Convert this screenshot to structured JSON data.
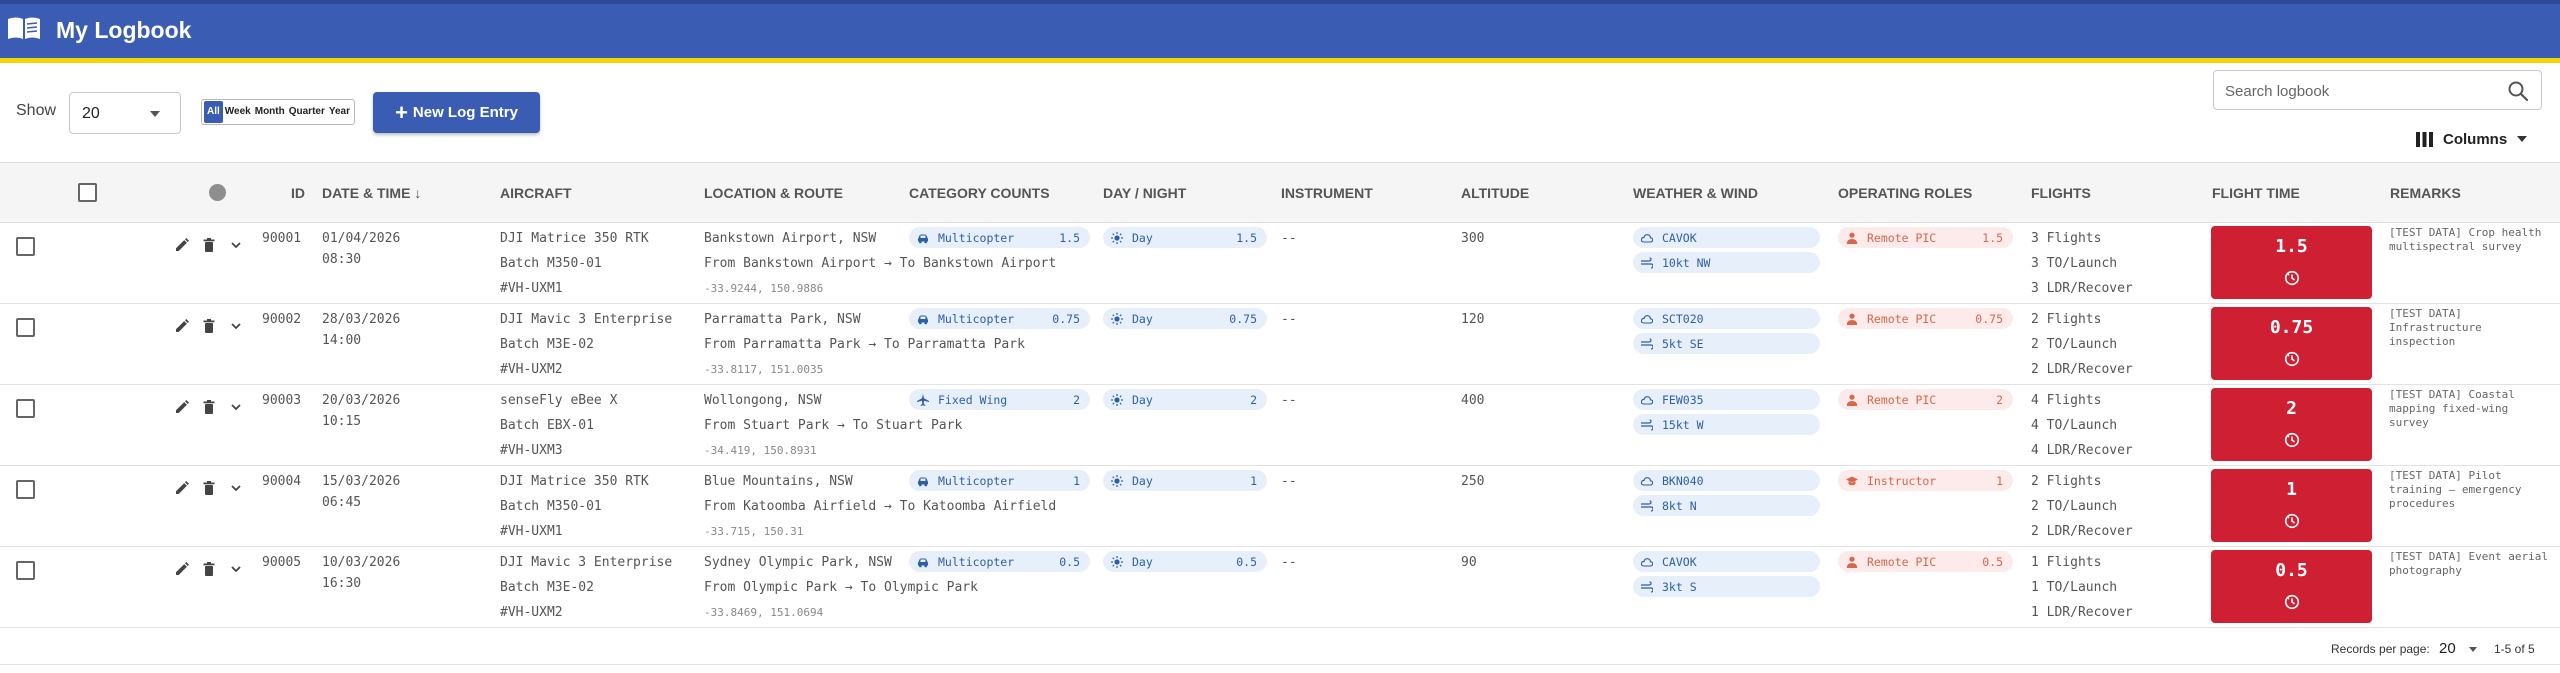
{
  "app": {
    "title": "My Logbook"
  },
  "search": {
    "placeholder": "Search logbook"
  },
  "toolbar": {
    "columns_label": "Columns",
    "show_label": "Show",
    "show_value": "20",
    "periods": [
      "All",
      "Week",
      "Month",
      "Quarter",
      "Year"
    ],
    "active_period": "All",
    "new_entry_label": "New Log Entry"
  },
  "table": {
    "headers": {
      "id": "ID",
      "datetime": "DATE & TIME",
      "aircraft": "AIRCRAFT",
      "location": "LOCATION & ROUTE",
      "category": "CATEGORY COUNTS",
      "daynight": "DAY / NIGHT",
      "instrument": "INSTRUMENT",
      "altitude": "ALTITUDE",
      "weather": "WEATHER & WIND",
      "roles": "OPERATING ROLES",
      "flights": "FLIGHTS",
      "flight_time": "FLIGHT TIME",
      "remarks": "REMARKS"
    },
    "rows": [
      {
        "id": "90001",
        "date": "01/04/2026",
        "time": "08:30",
        "aircraft": "DJI Matrice 350 RTK",
        "batch": "Batch M350-01",
        "reg": "#VH-UXM1",
        "location": "Bankstown Airport, NSW",
        "route": "From Bankstown Airport → To Bankstown Airport",
        "coords": "-33.9244, 150.9886",
        "category": "Multicopter",
        "category_icon": "car-icon",
        "category_value": "1.5",
        "daynight": "Day",
        "daynight_value": "1.5",
        "instrument": "--",
        "altitude": "300",
        "weather": "CAVOK",
        "wind": "10kt NW",
        "role": "Remote PIC",
        "role_icon": "person-icon",
        "role_value": "1.5",
        "flights": "3 Flights",
        "to_launch": "3 TO/Launch",
        "ldr_recover": "3 LDR/Recover",
        "flight_time": "1.5",
        "remarks": "[TEST DATA] Crop health multispectral survey"
      },
      {
        "id": "90002",
        "date": "28/03/2026",
        "time": "14:00",
        "aircraft": "DJI Mavic 3 Enterprise",
        "batch": "Batch M3E-02",
        "reg": "#VH-UXM2",
        "location": "Parramatta Park, NSW",
        "route": "From Parramatta Park → To Parramatta Park",
        "coords": "-33.8117, 151.0035",
        "category": "Multicopter",
        "category_icon": "car-icon",
        "category_value": "0.75",
        "daynight": "Day",
        "daynight_value": "0.75",
        "instrument": "--",
        "altitude": "120",
        "weather": "SCT020",
        "wind": "5kt SE",
        "role": "Remote PIC",
        "role_icon": "person-icon",
        "role_value": "0.75",
        "flights": "2 Flights",
        "to_launch": "2 TO/Launch",
        "ldr_recover": "2 LDR/Recover",
        "flight_time": "0.75",
        "remarks": "[TEST DATA] Infrastructure inspection"
      },
      {
        "id": "90003",
        "date": "20/03/2026",
        "time": "10:15",
        "aircraft": "senseFly eBee X",
        "batch": "Batch EBX-01",
        "reg": "#VH-UXM3",
        "location": "Wollongong, NSW",
        "route": "From Stuart Park → To Stuart Park",
        "coords": "-34.419, 150.8931",
        "category": "Fixed Wing",
        "category_icon": "airplane-icon",
        "category_value": "2",
        "daynight": "Day",
        "daynight_value": "2",
        "instrument": "--",
        "altitude": "400",
        "weather": "FEW035",
        "wind": "15kt W",
        "role": "Remote PIC",
        "role_icon": "person-icon",
        "role_value": "2",
        "flights": "4 Flights",
        "to_launch": "4 TO/Launch",
        "ldr_recover": "4 LDR/Recover",
        "flight_time": "2",
        "remarks": "[TEST DATA] Coastal mapping fixed-wing survey"
      },
      {
        "id": "90004",
        "date": "15/03/2026",
        "time": "06:45",
        "aircraft": "DJI Matrice 350 RTK",
        "batch": "Batch M350-01",
        "reg": "#VH-UXM1",
        "location": "Blue Mountains, NSW",
        "route": "From Katoomba Airfield → To Katoomba Airfield",
        "coords": "-33.715, 150.31",
        "category": "Multicopter",
        "category_icon": "car-icon",
        "category_value": "1",
        "daynight": "Day",
        "daynight_value": "1",
        "instrument": "--",
        "altitude": "250",
        "weather": "BKN040",
        "wind": "8kt N",
        "role": "Instructor",
        "role_icon": "graduation-cap-icon",
        "role_value": "1",
        "flights": "2 Flights",
        "to_launch": "2 TO/Launch",
        "ldr_recover": "2 LDR/Recover",
        "flight_time": "1",
        "remarks": "[TEST DATA] Pilot training — emergency procedures"
      },
      {
        "id": "90005",
        "date": "10/03/2026",
        "time": "16:30",
        "aircraft": "DJI Mavic 3 Enterprise",
        "batch": "Batch M3E-02",
        "reg": "#VH-UXM2",
        "location": "Sydney Olympic Park, NSW",
        "route": "From Olympic Park → To Olympic Park",
        "coords": "-33.8469, 151.0694",
        "category": "Multicopter",
        "category_icon": "car-icon",
        "category_value": "0.5",
        "daynight": "Day",
        "daynight_value": "0.5",
        "instrument": "--",
        "altitude": "90",
        "weather": "CAVOK",
        "wind": "3kt S",
        "role": "Remote PIC",
        "role_icon": "person-icon",
        "role_value": "0.5",
        "flights": "1 Flights",
        "to_launch": "1 TO/Launch",
        "ldr_recover": "1 LDR/Recover",
        "flight_time": "0.5",
        "remarks": "[TEST DATA] Event aerial photography"
      }
    ]
  },
  "pagination": {
    "records_per_page_label": "Records per page:",
    "records_per_page": "20",
    "range": "1-5 of 5"
  },
  "colors": {
    "header_blue": "#3a5db3",
    "header_stripe": "#f2d600",
    "flight_time_red": "#cf1f33",
    "chip_blue_bg": "#e7effa",
    "chip_role_bg": "#fdeaea"
  }
}
